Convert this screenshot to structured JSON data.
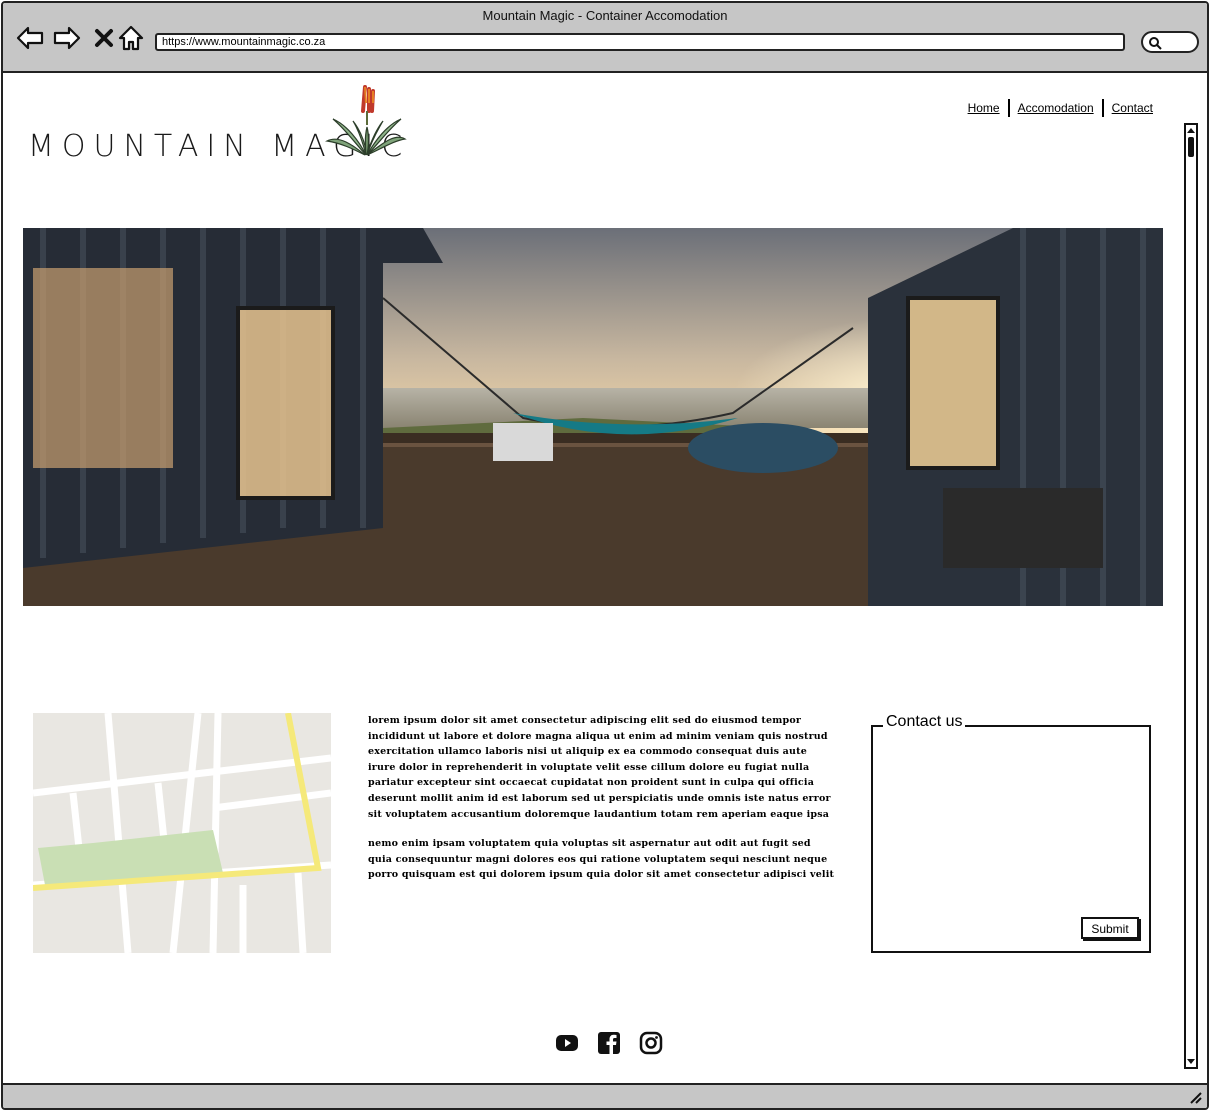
{
  "window": {
    "title": "Mountain Magic - Container Accomodation",
    "url": "https://www.mountainmagic.co.za"
  },
  "logo": {
    "text": "MOUNTAIN MAGIC"
  },
  "nav": {
    "items": [
      {
        "label": "Home"
      },
      {
        "label": "Accomodation"
      },
      {
        "label": "Contact"
      }
    ]
  },
  "hero": {
    "description": "Shipping-container cabins on a wooden deck with a hammock at sunset over the sea"
  },
  "body_text": {
    "paragraphs": [
      "lorem ipsum dolor sit amet consectetur adipiscing elit sed do eiusmod tempor incididunt ut labore et dolore magna aliqua ut enim ad minim veniam quis nostrud exercitation ullamco laboris nisi ut aliquip ex ea commodo consequat duis aute irure dolor in reprehenderit in voluptate velit esse cillum dolore eu fugiat nulla pariatur excepteur sint occaecat cupidatat non proident sunt in culpa qui officia deserunt mollit anim id est laborum sed ut perspiciatis unde omnis iste natus error sit voluptatem accusantium doloremque laudantium totam rem aperiam eaque ipsa",
      "nemo enim ipsam voluptatem quia voluptas sit aspernatur aut odit aut fugit sed quia consequuntur magni dolores eos qui ratione voluptatem sequi nesciunt neque porro quisquam est qui dolorem ipsum quia dolor sit amet consectetur adipisci velit"
    ]
  },
  "contact": {
    "legend": "Contact us",
    "submit_label": "Submit"
  },
  "social": {
    "icons": [
      "youtube-icon",
      "facebook-icon",
      "instagram-icon"
    ]
  },
  "colors": {
    "chrome": "#c6c6c6",
    "map_road_yellow": "#f5e97a",
    "map_park": "#c9dfb4",
    "map_block": "#e9e7e2"
  }
}
